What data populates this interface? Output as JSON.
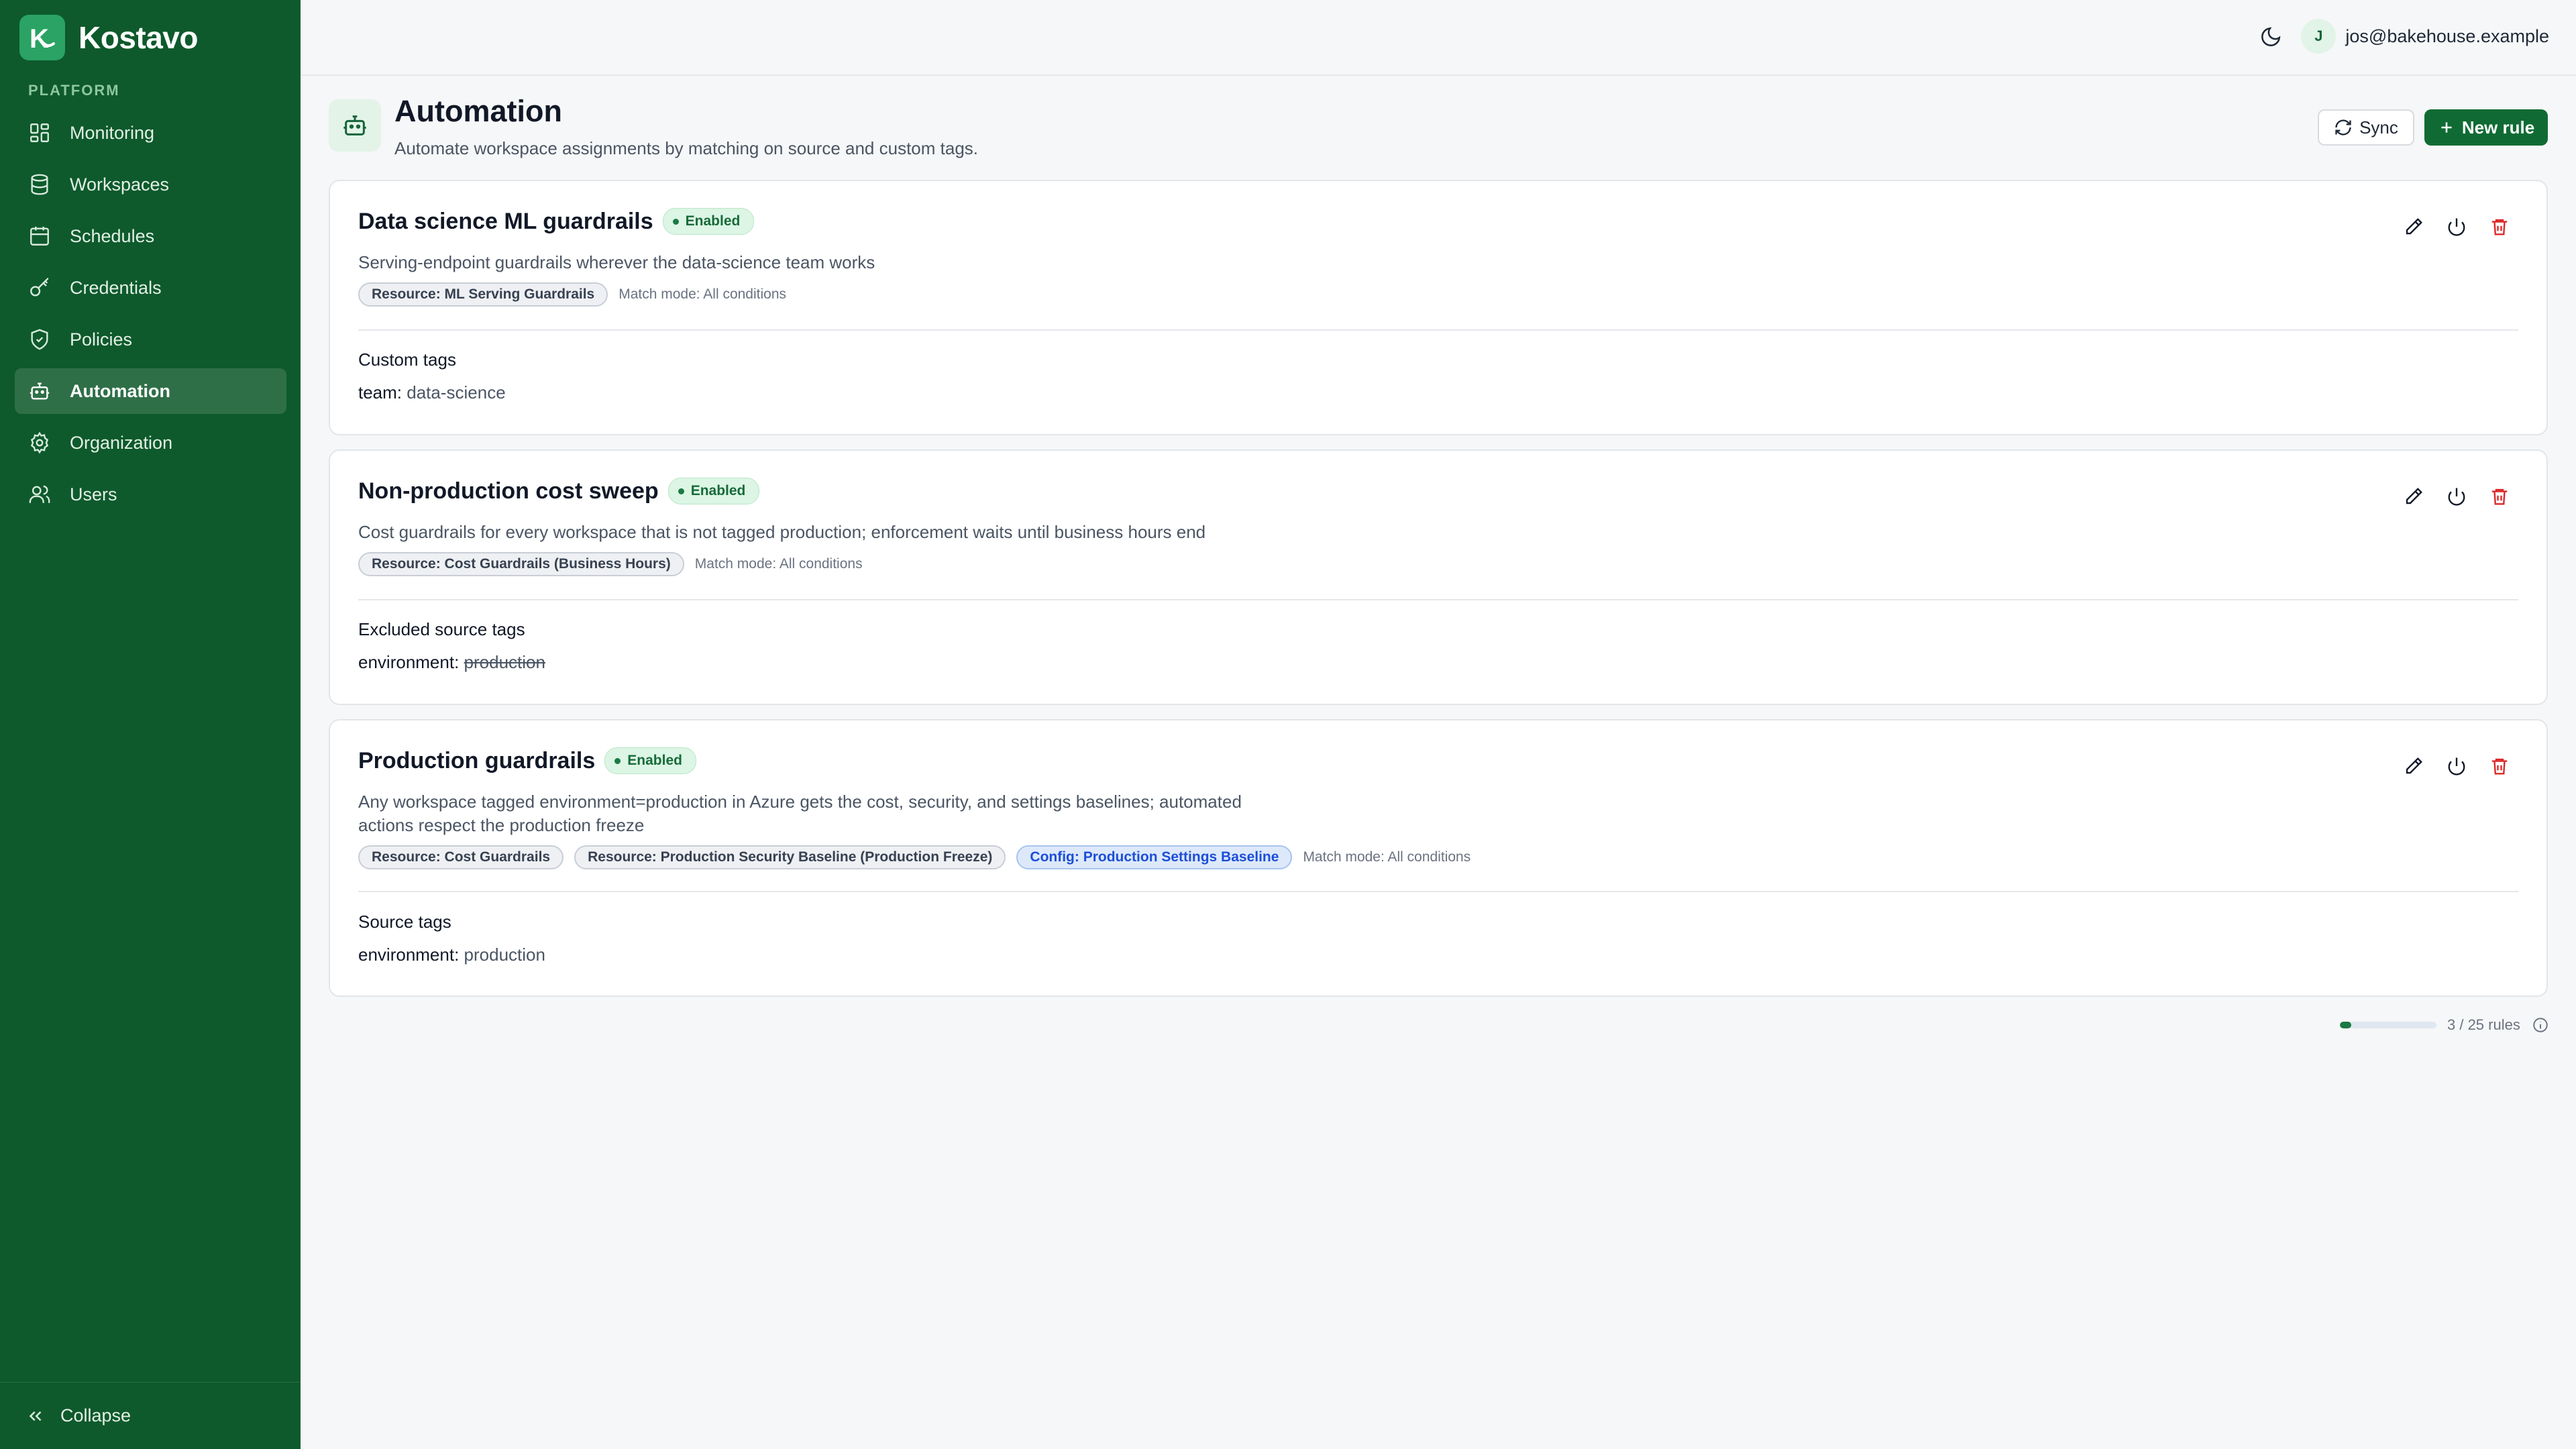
{
  "app": {
    "name": "Kostavo",
    "logo_letter": "K",
    "accent": "#0f6b33"
  },
  "sidebar": {
    "section_label": "PLATFORM",
    "items": [
      {
        "label": "Monitoring",
        "icon": "dashboard-icon"
      },
      {
        "label": "Workspaces",
        "icon": "database-icon"
      },
      {
        "label": "Schedules",
        "icon": "calendar-icon"
      },
      {
        "label": "Credentials",
        "icon": "key-icon"
      },
      {
        "label": "Policies",
        "icon": "shield-icon"
      },
      {
        "label": "Automation",
        "icon": "bot-icon",
        "active": true
      },
      {
        "label": "Organization",
        "icon": "gear-icon"
      },
      {
        "label": "Users",
        "icon": "users-icon"
      }
    ],
    "collapse_label": "Collapse"
  },
  "header": {
    "theme_icon": "moon-icon",
    "user": {
      "initial": "J",
      "email": "jos@bakehouse.example"
    }
  },
  "page": {
    "title": "Automation",
    "subtitle": "Automate workspace assignments by matching on source and custom tags.",
    "sync_label": "Sync",
    "new_rule_label": "New rule"
  },
  "rules": [
    {
      "name": "Data science ML guardrails",
      "status": "Enabled",
      "description": "Serving-endpoint guardrails wherever the data-science team works",
      "chips": [
        {
          "label": "Resource: ML Serving Guardrails",
          "kind": "resource"
        }
      ],
      "match_mode": "Match mode: All conditions",
      "tag_section": "Custom tags",
      "tag": {
        "key": "team:",
        "value": "data-science",
        "excluded": false
      }
    },
    {
      "name": "Non-production cost sweep",
      "status": "Enabled",
      "description": "Cost guardrails for every workspace that is not tagged production; enforcement waits until business hours end",
      "chips": [
        {
          "label": "Resource: Cost Guardrails (Business Hours)",
          "kind": "resource"
        }
      ],
      "match_mode": "Match mode: All conditions",
      "tag_section": "Excluded source tags",
      "tag": {
        "key": "environment:",
        "value": "production",
        "excluded": true
      }
    },
    {
      "name": "Production guardrails",
      "status": "Enabled",
      "description_lines": [
        "Any workspace tagged environment=production in Azure gets the cost, security, and settings baselines; automated",
        "actions respect the production freeze"
      ],
      "chips": [
        {
          "label": "Resource: Cost Guardrails",
          "kind": "resource"
        },
        {
          "label": "Resource: Production Security Baseline (Production Freeze)",
          "kind": "resource"
        },
        {
          "label": "Config: Production Settings Baseline",
          "kind": "config"
        }
      ],
      "match_mode": "Match mode: All conditions",
      "tag_section": "Source tags",
      "tag": {
        "key": "environment:",
        "value": "production",
        "excluded": false
      }
    }
  ],
  "usage": {
    "text": "3 / 25 rules",
    "used": 3,
    "limit": 25
  }
}
